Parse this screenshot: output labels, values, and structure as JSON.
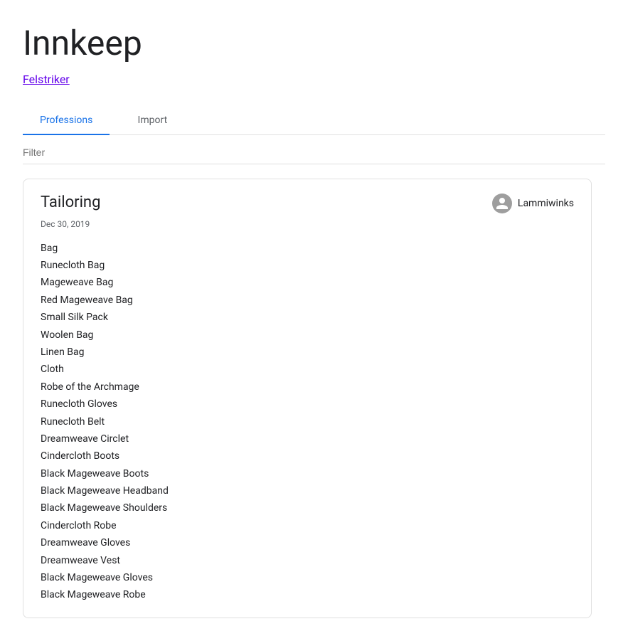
{
  "app": {
    "title": "Innkeep",
    "realm_link": "Felstriker"
  },
  "tabs": [
    {
      "id": "professions",
      "label": "Professions",
      "active": true
    },
    {
      "id": "import",
      "label": "Import",
      "active": false
    }
  ],
  "filter": {
    "placeholder": "Filter",
    "value": ""
  },
  "profession_card": {
    "title": "Tailoring",
    "date": "Dec 30, 2019",
    "user": "Lammiwinks",
    "items": [
      "Bag",
      "Runecloth Bag",
      "Mageweave Bag",
      "Red Mageweave Bag",
      "Small Silk Pack",
      "Woolen Bag",
      "Linen Bag",
      "Cloth",
      "Robe of the Archmage",
      "Runecloth Gloves",
      "Runecloth Belt",
      "Dreamweave Circlet",
      "Cindercloth Boots",
      "Black Mageweave Boots",
      "Black Mageweave Headband",
      "Black Mageweave Shoulders",
      "Cindercloth Robe",
      "Dreamweave Gloves",
      "Dreamweave Vest",
      "Black Mageweave Gloves",
      "Black Mageweave Robe"
    ]
  }
}
